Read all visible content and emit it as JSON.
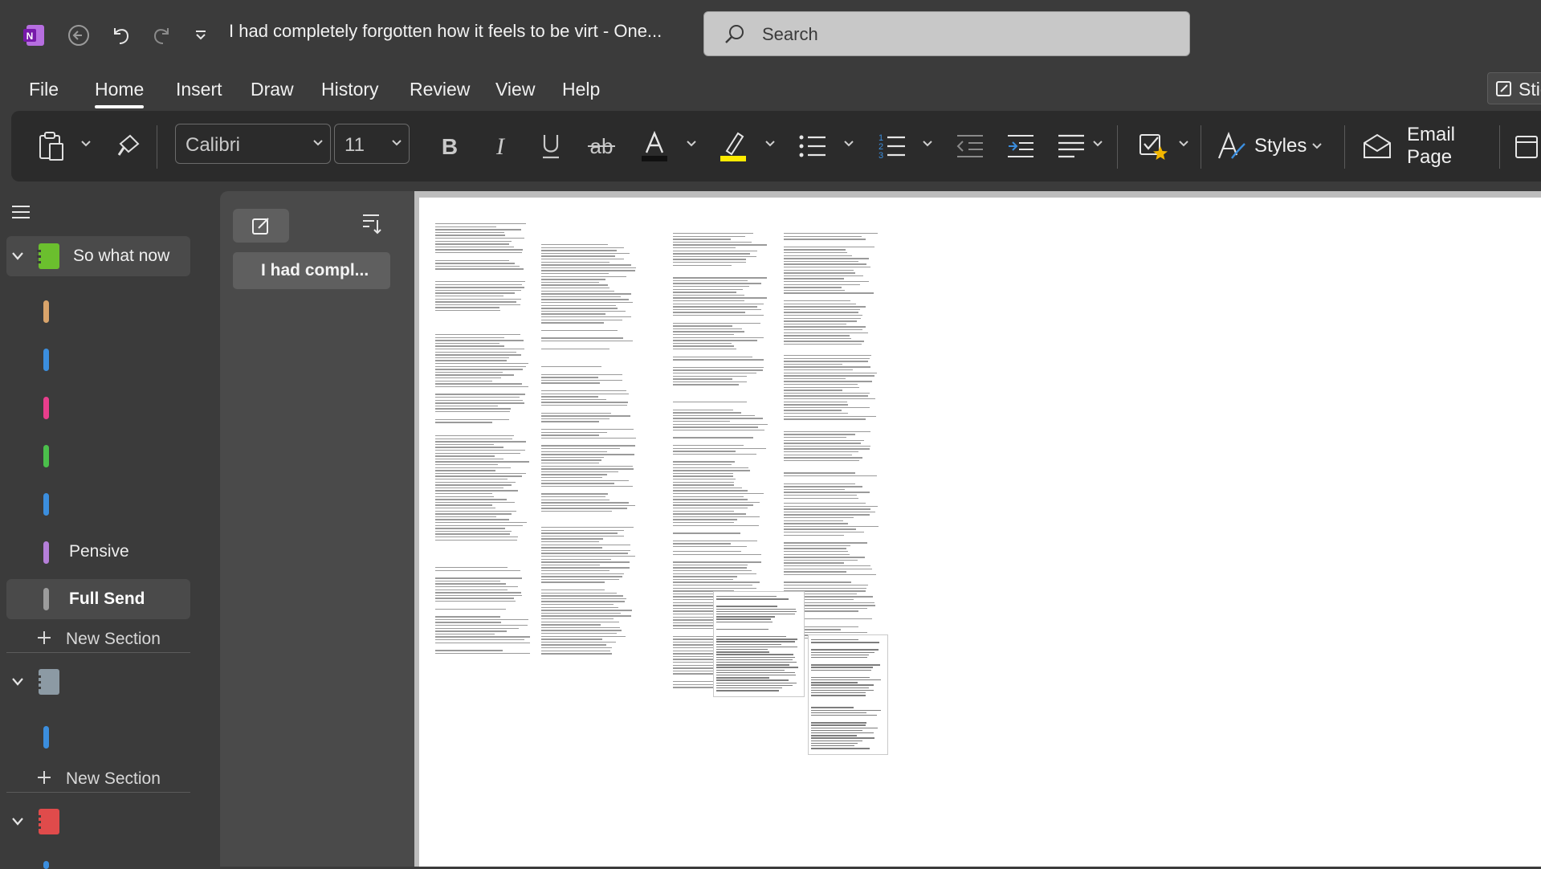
{
  "titlebar": {
    "title": "I had completely forgotten how it feels to be virt  -  One...",
    "search_placeholder": "Search",
    "app_icon": "onenote-logo-icon",
    "back_icon": "back-arrow-icon",
    "undo_icon": "undo-icon",
    "redo_icon": "redo-icon",
    "customize_icon": "quick-access-dropdown-icon"
  },
  "menu": {
    "tabs": [
      "File",
      "Home",
      "Insert",
      "Draw",
      "History",
      "Review",
      "View",
      "Help"
    ],
    "active": "Home",
    "sticky_label": "Stic"
  },
  "ribbon": {
    "font_name": "Calibri",
    "font_size": "11",
    "styles_label": "Styles",
    "email_label": "Email Page",
    "font_color": "#111111",
    "highlight_color": "#ffeb00",
    "indent_accent": "#3b8ede"
  },
  "notebooks": [
    {
      "name": "So what now",
      "color": "#6bbf2e",
      "sections": [
        {
          "label": "",
          "color": "#d9a46b"
        },
        {
          "label": "",
          "color": "#3b8ede"
        },
        {
          "label": "",
          "color": "#e83e8c"
        },
        {
          "label": "",
          "color": "#4bbf4b"
        },
        {
          "label": "",
          "color": "#3b8ede"
        },
        {
          "label": "Pensive",
          "color": "#b57fd9"
        },
        {
          "label": "Full Send",
          "color": "#9c9c9c",
          "selected": true
        }
      ],
      "new_section": "New Section"
    },
    {
      "name": "",
      "color": "#8c9aa4",
      "sections": [
        {
          "label": "",
          "color": "#3b8ede"
        }
      ],
      "new_section": "New Section"
    },
    {
      "name": "",
      "color": "#e04b4b",
      "sections": []
    }
  ],
  "pages": [
    {
      "title": "I had compl..."
    }
  ]
}
